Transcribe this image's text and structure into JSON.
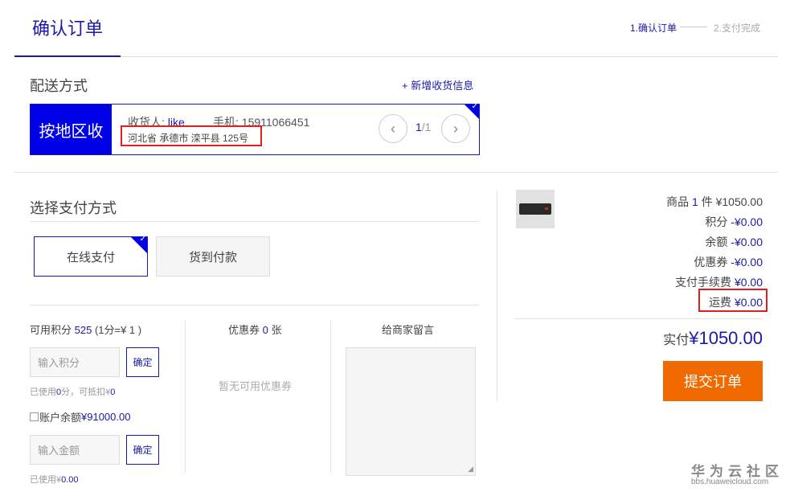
{
  "header": {
    "title": "确认订单",
    "step1": "1.确认订单",
    "step2": "2.支付完成"
  },
  "delivery": {
    "title": "配送方式",
    "add_address": "+ 新增收货信息",
    "region_label": "按地区收",
    "recipient_prefix": "收货人: ",
    "recipient_name": "like",
    "phone": "手机: 15911066451",
    "address": "河北省 承德市 滦平县 125号",
    "page_current": "1",
    "page_total": "/1"
  },
  "payment": {
    "title": "选择支付方式",
    "online": "在线支付",
    "cod": "货到付款"
  },
  "points": {
    "label_prefix": "可用积分 ",
    "count": "525",
    "label_suffix": " (1分=¥ 1 )",
    "placeholder": "输入积分",
    "confirm": "确定",
    "used_prefix": "已使用",
    "used_count": "0",
    "used_mid": "分，可抵扣¥",
    "used_value": "0"
  },
  "balance": {
    "label": "账户余额 ",
    "amount": "¥91000.00",
    "placeholder": "输入金额",
    "confirm": "确定",
    "used_prefix": "已使用¥",
    "used_value": "0.00"
  },
  "coupon": {
    "label_prefix": "优惠券 ",
    "count": "0",
    "label_suffix": " 张",
    "empty": "暂无可用优惠券"
  },
  "message": {
    "label": "给商家留言"
  },
  "summary": {
    "goods_prefix": "商品 ",
    "goods_count": "1",
    "goods_suffix": " 件 ¥1050.00",
    "points_label": "积分 ",
    "points_value": "-¥0.00",
    "balance_label": "余额 ",
    "balance_value": "-¥0.00",
    "coupon_label": "优惠券 ",
    "coupon_value": "-¥0.00",
    "fee_label": "支付手续费 ",
    "fee_value": "¥0.00",
    "shipping_label": "运费 ",
    "shipping_value": "¥0.00",
    "total_label": "实付",
    "total_value": "¥1050.00",
    "submit": "提交订单"
  },
  "watermark": {
    "brand": "华为云社区",
    "url": "bbs.huaweicloud.com"
  }
}
